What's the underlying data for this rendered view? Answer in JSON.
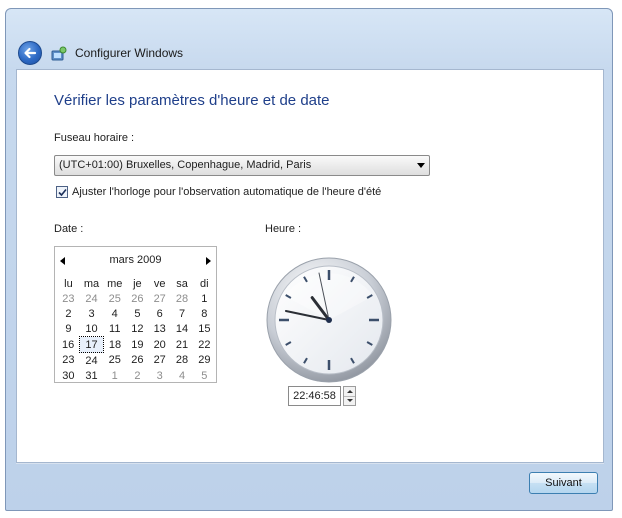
{
  "window": {
    "title": "Configurer Windows"
  },
  "page": {
    "heading": "Vérifier les paramètres d'heure et de date"
  },
  "timezone": {
    "label": "Fuseau horaire :",
    "value": "(UTC+01:00) Bruxelles, Copenhague, Madrid, Paris"
  },
  "dst": {
    "label": "Ajuster l'horloge pour l'observation automatique de l'heure d'été",
    "checked": true
  },
  "date": {
    "label": "Date :",
    "month_year": "mars 2009",
    "weekdays": [
      "lu",
      "ma",
      "me",
      "je",
      "ve",
      "sa",
      "di"
    ],
    "weeks": [
      [
        {
          "d": "23",
          "o": true
        },
        {
          "d": "24",
          "o": true
        },
        {
          "d": "25",
          "o": true
        },
        {
          "d": "26",
          "o": true
        },
        {
          "d": "27",
          "o": true
        },
        {
          "d": "28",
          "o": true
        },
        {
          "d": "1",
          "o": false
        }
      ],
      [
        {
          "d": "2",
          "o": false
        },
        {
          "d": "3",
          "o": false
        },
        {
          "d": "4",
          "o": false
        },
        {
          "d": "5",
          "o": false
        },
        {
          "d": "6",
          "o": false
        },
        {
          "d": "7",
          "o": false
        },
        {
          "d": "8",
          "o": false
        }
      ],
      [
        {
          "d": "9",
          "o": false
        },
        {
          "d": "10",
          "o": false
        },
        {
          "d": "11",
          "o": false
        },
        {
          "d": "12",
          "o": false
        },
        {
          "d": "13",
          "o": false
        },
        {
          "d": "14",
          "o": false
        },
        {
          "d": "15",
          "o": false
        }
      ],
      [
        {
          "d": "16",
          "o": false
        },
        {
          "d": "17",
          "o": false,
          "sel": true
        },
        {
          "d": "18",
          "o": false
        },
        {
          "d": "19",
          "o": false
        },
        {
          "d": "20",
          "o": false
        },
        {
          "d": "21",
          "o": false
        },
        {
          "d": "22",
          "o": false
        }
      ],
      [
        {
          "d": "23",
          "o": false
        },
        {
          "d": "24",
          "o": false
        },
        {
          "d": "25",
          "o": false
        },
        {
          "d": "26",
          "o": false
        },
        {
          "d": "27",
          "o": false
        },
        {
          "d": "28",
          "o": false
        },
        {
          "d": "29",
          "o": false
        }
      ],
      [
        {
          "d": "30",
          "o": false
        },
        {
          "d": "31",
          "o": false
        },
        {
          "d": "1",
          "o": true
        },
        {
          "d": "2",
          "o": true
        },
        {
          "d": "3",
          "o": true
        },
        {
          "d": "4",
          "o": true
        },
        {
          "d": "5",
          "o": true
        }
      ]
    ]
  },
  "time": {
    "label": "Heure :",
    "value": "22:46:58",
    "hours": 22,
    "minutes": 46,
    "seconds": 58
  },
  "buttons": {
    "next": "Suivant"
  },
  "icons": {
    "back": "back-arrow-icon",
    "app": "windows-setup-icon",
    "prev_month": "triangle-left-icon",
    "next_month": "triangle-right-icon",
    "dropdown": "chevron-down-icon"
  }
}
